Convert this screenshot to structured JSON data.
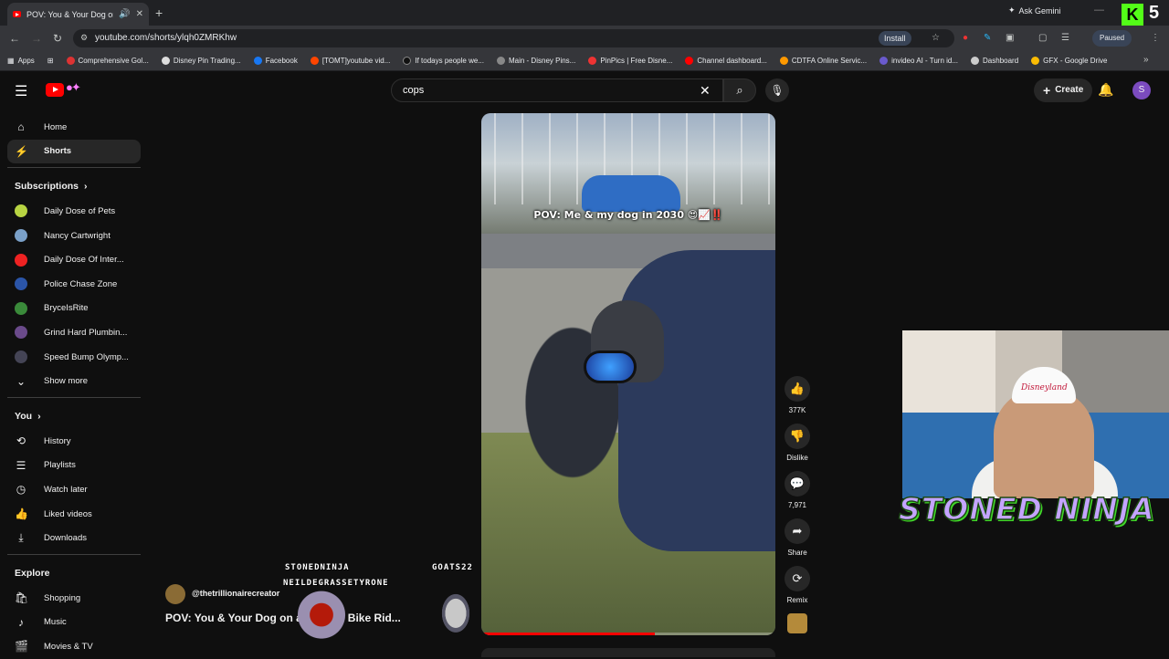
{
  "browser": {
    "tab_title": "POV: You & Your Dog on a",
    "tab_audio_icon": "speaker-icon",
    "url": "youtube.com/shorts/ylqh0ZMRKhw",
    "install_label": "Install",
    "gemini_label": "Ask Gemini",
    "profile_status": "Paused",
    "kick_number": "5",
    "bookmarks": [
      "Apps",
      "Comprehensive Gol...",
      "Disney Pin Trading...",
      "Facebook",
      "[TOMT]youtube vid...",
      "If todays people we...",
      "Main - Disney Pins...",
      "PinPics | Free Disne...",
      "Channel dashboard...",
      "CDTFA Online Servic...",
      "invideo AI - Turn id...",
      "Dashboard",
      "GFX - Google Drive"
    ]
  },
  "header": {
    "search_value": "cops",
    "create_label": "Create",
    "avatar_letter": "S"
  },
  "sidebar": {
    "main": [
      {
        "label": "Home",
        "icon": "home-icon"
      },
      {
        "label": "Shorts",
        "icon": "shorts-icon"
      }
    ],
    "subscriptions_title": "Subscriptions",
    "subscriptions": [
      {
        "label": "Daily Dose of Pets",
        "color": "#b7d342"
      },
      {
        "label": "Nancy Cartwright",
        "color": "#7aa0c8"
      },
      {
        "label": "Daily Dose Of Inter...",
        "color": "#e22"
      },
      {
        "label": "Police Chase Zone",
        "color": "#2b55a8"
      },
      {
        "label": "BryceIsRite",
        "color": "#3a8a3a"
      },
      {
        "label": "Grind Hard Plumbin...",
        "color": "#6a4a8a"
      },
      {
        "label": "Speed Bump Olymp...",
        "color": "#445"
      }
    ],
    "show_more": "Show more",
    "you_title": "You",
    "you_items": [
      {
        "label": "History",
        "icon": "history-icon"
      },
      {
        "label": "Playlists",
        "icon": "playlists-icon"
      },
      {
        "label": "Watch later",
        "icon": "watch-later-icon"
      },
      {
        "label": "Liked videos",
        "icon": "liked-icon"
      },
      {
        "label": "Downloads",
        "icon": "download-icon"
      }
    ],
    "explore_title": "Explore",
    "explore_items": [
      {
        "label": "Shopping",
        "icon": "shopping-icon"
      },
      {
        "label": "Music",
        "icon": "music-icon"
      },
      {
        "label": "Movies & TV",
        "icon": "movies-icon"
      }
    ]
  },
  "short": {
    "caption": "POV: Me & my dog in 2030 😍📈‼️",
    "channel": "@thetrillionairecreator",
    "title": "POV: You & Your Dog on a Sunday Bike Rid...",
    "progress": 0.59,
    "likes": "377K",
    "dislike_label": "Dislike",
    "comments": "7,971",
    "share_label": "Share",
    "remix_label": "Remix"
  },
  "stream_overlay": {
    "viewer_1": "STONEDNINJA",
    "viewer_2": "NEILDEGRASSETYRONE",
    "viewer_3": "GOATS22",
    "brand": "STONED NINJA",
    "hat_text": "Disneyland"
  }
}
